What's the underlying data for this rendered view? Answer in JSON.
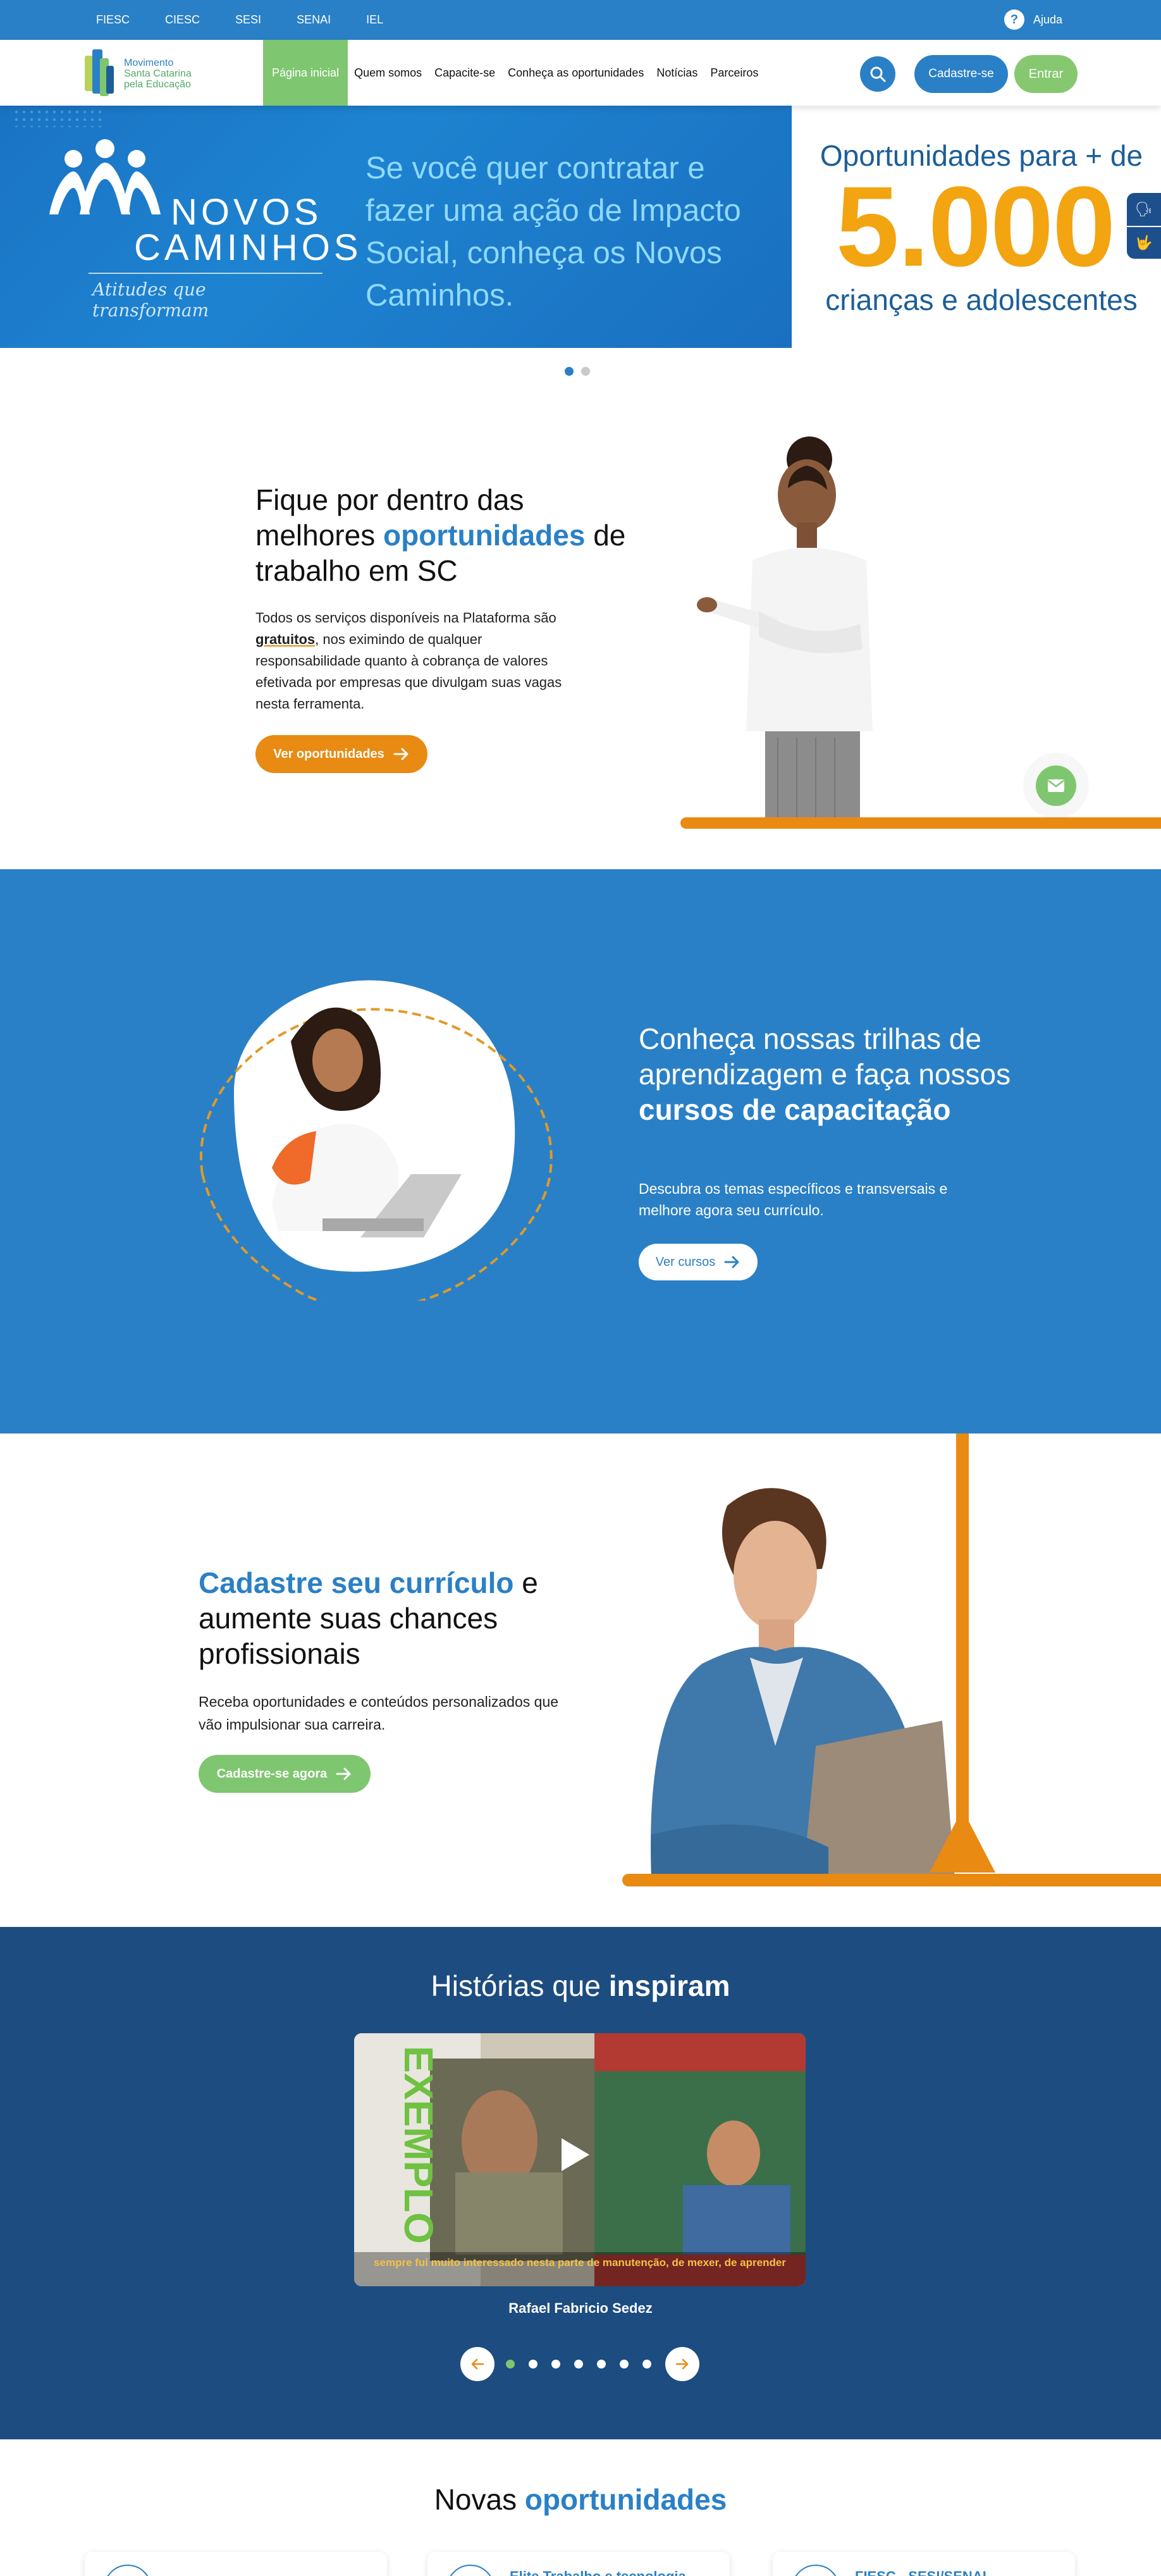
{
  "topbar": {
    "links": [
      "FIESC",
      "CIESC",
      "SESI",
      "SENAI",
      "IEL"
    ],
    "help_icon": "?",
    "help_label": "Ajuda"
  },
  "header": {
    "logo_lines": [
      "Movimento",
      "Santa Catarina",
      "pela Educação"
    ],
    "menu": [
      "Página inicial",
      "Quem somos",
      "Capacite-se",
      "Conheça as oportunidades",
      "Notícias",
      "Parceiros"
    ],
    "active_menu": "Página inicial",
    "search_icon": "search-icon",
    "cadastre_label": "Cadastre-se",
    "entrar_label": "Entrar"
  },
  "banner": {
    "brand_line1": "NOVOS",
    "brand_line2": "CAMINHOS",
    "tagline": "Atitudes que transformam",
    "message": "Se você quer contratar e fazer uma ação de Impacto Social, conheça os Novos Caminhos.",
    "right_top": "Oportunidades para + de",
    "right_number": "5.000",
    "right_bottom": "crianças e adolescentes",
    "accessibility_icons": [
      "🗣",
      "🤟"
    ]
  },
  "opportunities": {
    "title_a": "Fique por dentro das melhores ",
    "title_highlight": "oportunidades",
    "title_b": " de trabalho em SC",
    "text_a": "Todos os serviços disponíveis na Plataforma são ",
    "text_bold": "gratuitos",
    "text_b": ", nos eximindo de qualquer responsabilidade quanto à cobrança de valores efetivada por empresas que divulgam suas vagas nesta ferramenta.",
    "button_label": "Ver oportunidades"
  },
  "courses": {
    "title_a": "Conheça nossas trilhas de aprendizagem e faça nossos ",
    "title_bold": "cursos de capacitação",
    "text": "Descubra os temas específicos e transversais e melhore agora seu currículo.",
    "button_label": "Ver cursos"
  },
  "signup": {
    "title_highlight": "Cadastre seu currículo",
    "title_rest": " e aumente suas chances profissionais",
    "text": "Receba oportunidades e conteúdos personalizados que vão impulsionar sua carreira.",
    "button_label": "Cadastre-se agora"
  },
  "stories": {
    "title_a": "Histórias que ",
    "title_bold": "inspiram",
    "video_subtitle": "sempre fui muito interessado nesta parte de manutenção, de mexer, de aprender",
    "video_overlay_text": "EXEMPLO",
    "person_name": "Rafael Fabricio Sedez",
    "dots_count": 7,
    "active_dot": 0
  },
  "new_opps": {
    "title_a": "Novas ",
    "title_highlight": "oportunidades",
    "cards": [
      "",
      "Elite Trabalho e tecnologia",
      "FIESC - SESI/SENAI"
    ]
  },
  "colors": {
    "primary_blue": "#2a80c6",
    "dark_blue": "#1c4c80",
    "green": "#7fc670",
    "orange": "#e98a12",
    "gold": "#f3a411"
  }
}
